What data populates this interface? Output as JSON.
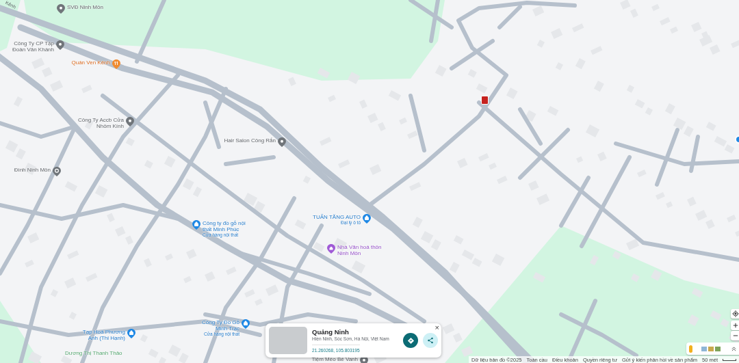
{
  "map": {
    "road_labels": [
      {
        "text": "Kênh"
      }
    ],
    "pois": [
      {
        "name": "SVĐ Ninh Môn",
        "kind": "place"
      },
      {
        "name": "Công Ty CP Tập Đoàn Vân Khánh",
        "kind": "place"
      },
      {
        "name": "Quán Ven Kênh",
        "kind": "food"
      },
      {
        "name": "Công Ty Accb Cửa Nhôm Kính",
        "kind": "place"
      },
      {
        "name": "Đình Ninh Môn",
        "kind": "temple"
      },
      {
        "name": "Hair Salon Công Rắn",
        "kind": "place"
      },
      {
        "name": "Công ty đồ gỗ nội thất Minh Phúc",
        "subtitle": "Cửa hàng nội thất",
        "kind": "shop"
      },
      {
        "name": "TUẤN TĂNG AUTO",
        "subtitle": "Đại lý ô tô",
        "kind": "shop"
      },
      {
        "name": "Nhà Văn hoá thôn Ninh Môn",
        "kind": "community"
      },
      {
        "name": "Công Ty Đồ Gỗ Minh Trạc",
        "subtitle": "Cửa hàng nội thất",
        "kind": "shop"
      },
      {
        "name": "Tạp Hoá Phương Anh (Thi Hạnh)",
        "kind": "shop"
      },
      {
        "name": "Dương Thị Thanh Thảo",
        "kind": "street"
      },
      {
        "name": "Tiệm Mèo Bé Vanh",
        "kind": "place"
      }
    ]
  },
  "place_card": {
    "title": "Quảng Ninh",
    "address": "Hiền Ninh, Sóc Sơn, Hà Nội, Việt Nam",
    "coordinates": "21.260268, 105.803195",
    "close": "×"
  },
  "footer": {
    "links": [
      {
        "text": "Dữ liệu bản đồ ©2025"
      },
      {
        "text": "Toàn cầu"
      },
      {
        "text": "Điều khoản"
      },
      {
        "text": "Quyền riêng tư"
      },
      {
        "text": "Gửi ý kiến phản hồi về sản phẩm"
      }
    ],
    "scale": "50 mét"
  }
}
